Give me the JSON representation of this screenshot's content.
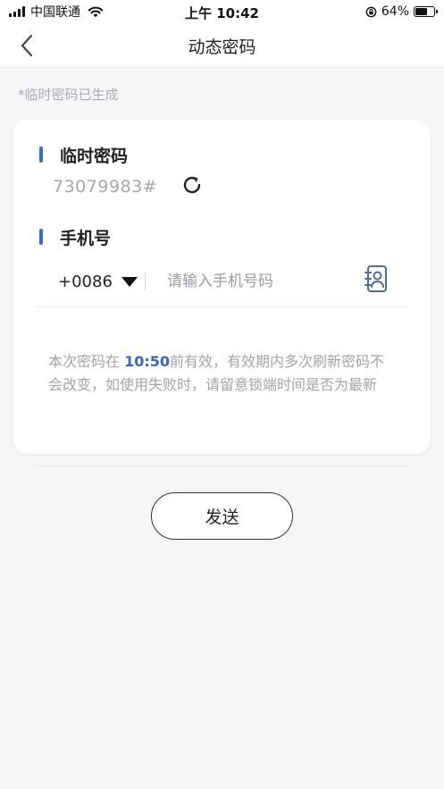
{
  "status_bar": {
    "carrier": "中国联通",
    "time": "上午 10:42",
    "battery_percent": "64%",
    "battery_level": 0.64
  },
  "nav": {
    "title": "动态密码",
    "back_icon": "chevron-left-icon"
  },
  "hint": "*临时密码已生成",
  "temp_password": {
    "title": "临时密码",
    "value": "73079983#",
    "refresh_icon": "refresh-icon"
  },
  "phone": {
    "title": "手机号",
    "country_code": "+0086",
    "placeholder": "请输入手机号码",
    "value": "",
    "contacts_icon": "contacts-book-icon"
  },
  "validity_note": {
    "prefix": "本次密码在 ",
    "time": "10:50",
    "suffix": "前有效，有效期内多次刷新密码不会改变，如使用失败时，请留意锁端时间是否为最新"
  },
  "send_button": "发送",
  "colors": {
    "accent": "#3b6ad9",
    "highlight_time": "#3a64c8",
    "background": "#f6f6f8",
    "card": "#ffffff",
    "muted_text": "#a3a3ab"
  }
}
